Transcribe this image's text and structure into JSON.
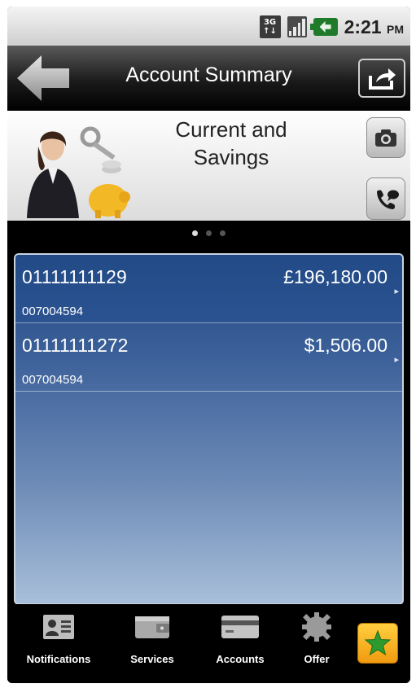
{
  "statusbar": {
    "network_label_top": "3G",
    "network_label_bottom": "↑↓",
    "time": "2:21",
    "ampm": "PM"
  },
  "header": {
    "title": "Account Summary"
  },
  "banner": {
    "title_line1": "Current and",
    "title_line2": "Savings"
  },
  "pager": {
    "count": 3,
    "active_index": 0
  },
  "accounts": [
    {
      "number": "01111111129",
      "balance": "£196,180.00",
      "sort_code": "007004594"
    },
    {
      "number": "01111111272",
      "balance": "$1,506.00",
      "sort_code": "007004594"
    }
  ],
  "bottom_nav": {
    "items": [
      {
        "label": "Notifications",
        "icon": "contact-card-icon"
      },
      {
        "label": "Services",
        "icon": "wallet-icon"
      },
      {
        "label": "Accounts",
        "icon": "credit-card-icon"
      },
      {
        "label": "Offer",
        "icon": "gear-icon"
      }
    ],
    "favorite_icon": "star-icon"
  },
  "colors": {
    "accent_blue": "#21477f",
    "favorite_gold": "#f5b324"
  }
}
